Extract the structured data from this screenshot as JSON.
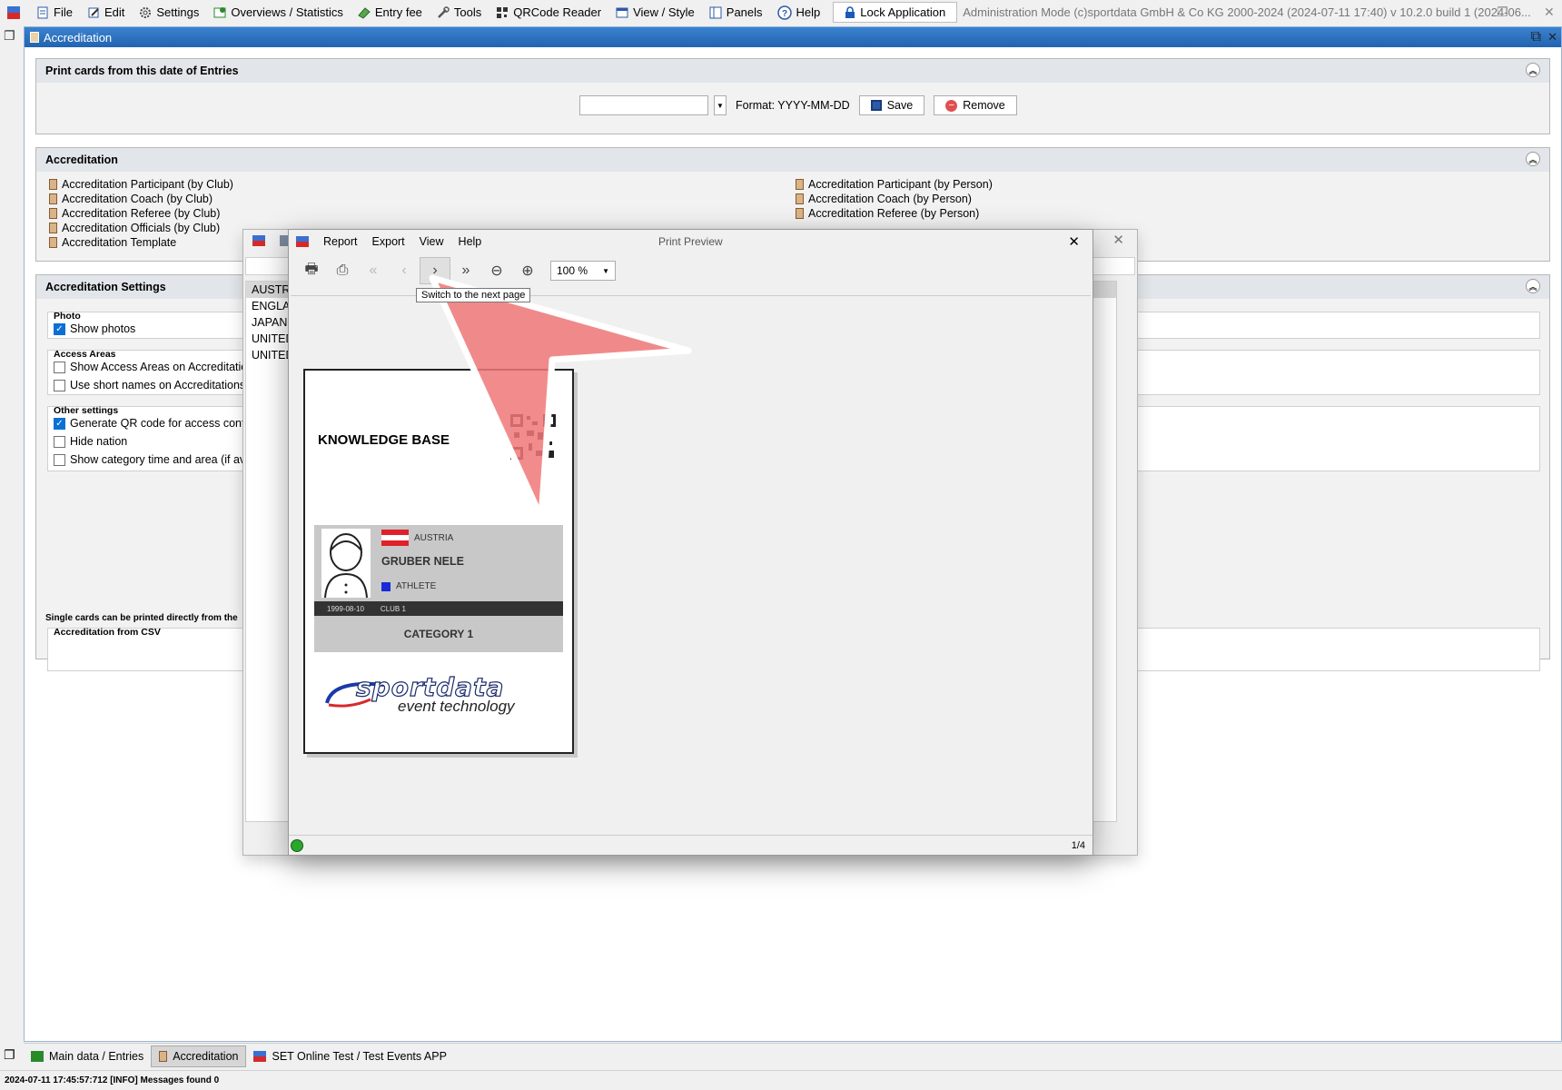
{
  "menubar": {
    "items": [
      "File",
      "Edit",
      "Settings",
      "Overviews / Statistics",
      "Entry fee",
      "Tools",
      "QRCode Reader",
      "View / Style",
      "Panels",
      "Help"
    ],
    "lock_label": "Lock Application",
    "title_info": "Administration Mode (c)sportdata GmbH & Co KG 2000-2024 (2024-07-11 17:40)  v 10.2.0 build 1 (2024-06..."
  },
  "doc": {
    "title": "Accreditation"
  },
  "print_section": {
    "title": "Print cards from this date of Entries",
    "date_value": "",
    "format_label": "Format: YYYY-MM-DD",
    "save_label": "Save",
    "remove_label": "Remove"
  },
  "accr_section": {
    "title": "Accreditation",
    "left_items": [
      "Accreditation Participant (by Club)",
      "Accreditation Coach (by Club)",
      "Accreditation Referee (by Club)",
      "Accreditation Officials (by Club)",
      "Accreditation Template"
    ],
    "right_items": [
      "Accreditation Participant (by Person)",
      "Accreditation Coach (by Person)",
      "Accreditation Referee (by Person)"
    ]
  },
  "settings_section": {
    "title": "Accreditation Settings",
    "photo_group": "Photo",
    "show_photos": "Show photos",
    "access_group": "Access Areas",
    "show_access": "Show Access Areas on Accreditations",
    "short_names": "Use short names on Accreditations",
    "other_group": "Other settings",
    "gen_qr": "Generate QR code for access control",
    "hide_nation": "Hide nation",
    "show_category": "Show category time and area (if avail",
    "single_note": "Single cards can be printed directly from the",
    "csv_group": "Accreditation from CSV"
  },
  "back_list": [
    "AUSTRIA",
    "ENGLAN",
    "JAPAN (",
    "UNITED",
    "UNITED"
  ],
  "preview": {
    "title": "Print Preview",
    "menu": [
      "Report",
      "Export",
      "View",
      "Help"
    ],
    "zoom": "100 %",
    "tooltip": "Switch to the next page",
    "page_indicator": "1/4",
    "card": {
      "header": "KNOWLEDGE BASE",
      "nation": "AUSTRIA",
      "name": "GRUBER NELE",
      "role": "ATHLETE",
      "dob": "1999-08-10",
      "club": "CLUB 1",
      "category": "CATEGORY 1",
      "logo_main": "sportdata",
      "logo_sub": "event technology"
    }
  },
  "bottom_tabs": [
    "Main data / Entries",
    "Accreditation",
    "SET Online Test / Test Events APP"
  ],
  "status": "2024-07-11 17:45:57:712 [INFO] Messages found 0",
  "colors": {
    "accent": "#2a6db8",
    "highlight": "#f07070",
    "flag_red": "#e0202a"
  }
}
